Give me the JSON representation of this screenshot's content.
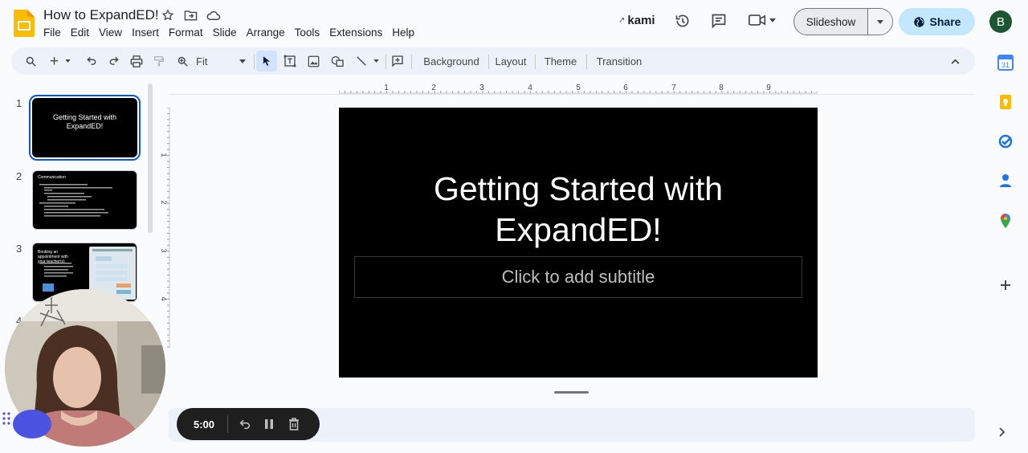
{
  "app": {
    "doc_title": "How to ExpandED!",
    "menu": [
      "File",
      "Edit",
      "View",
      "Insert",
      "Format",
      "Slide",
      "Arrange",
      "Tools",
      "Extensions",
      "Help"
    ]
  },
  "header": {
    "kami_label": "kami",
    "slideshow_label": "Slideshow",
    "share_label": "Share",
    "avatar_initial": "B"
  },
  "toolbar": {
    "zoom_value": "Fit",
    "background_label": "Background",
    "layout_label": "Layout",
    "theme_label": "Theme",
    "transition_label": "Transition"
  },
  "ruler": {
    "h_ticks": [
      "1",
      "2",
      "3",
      "4",
      "5",
      "6",
      "7",
      "8",
      "9"
    ],
    "v_ticks": [
      "1",
      "2",
      "3",
      "4"
    ]
  },
  "filmstrip": {
    "slides": [
      {
        "num": "1",
        "title": "Getting Started with ExpandED!"
      },
      {
        "num": "2",
        "title": "Communication"
      },
      {
        "num": "3",
        "title": "Booking an appointment with your teacher(s)"
      },
      {
        "num": "4"
      }
    ]
  },
  "slide": {
    "title_line1": "Getting Started with",
    "title_line2": "ExpandED!",
    "subtitle_placeholder": "Click to add subtitle"
  },
  "recorder": {
    "time": "5:00"
  },
  "colors": {
    "accent_blue": "#0b57d0",
    "share_bg": "#c2e7ff",
    "toolbar_bg": "#edf2fa",
    "avatar_bg": "#1e5631"
  }
}
